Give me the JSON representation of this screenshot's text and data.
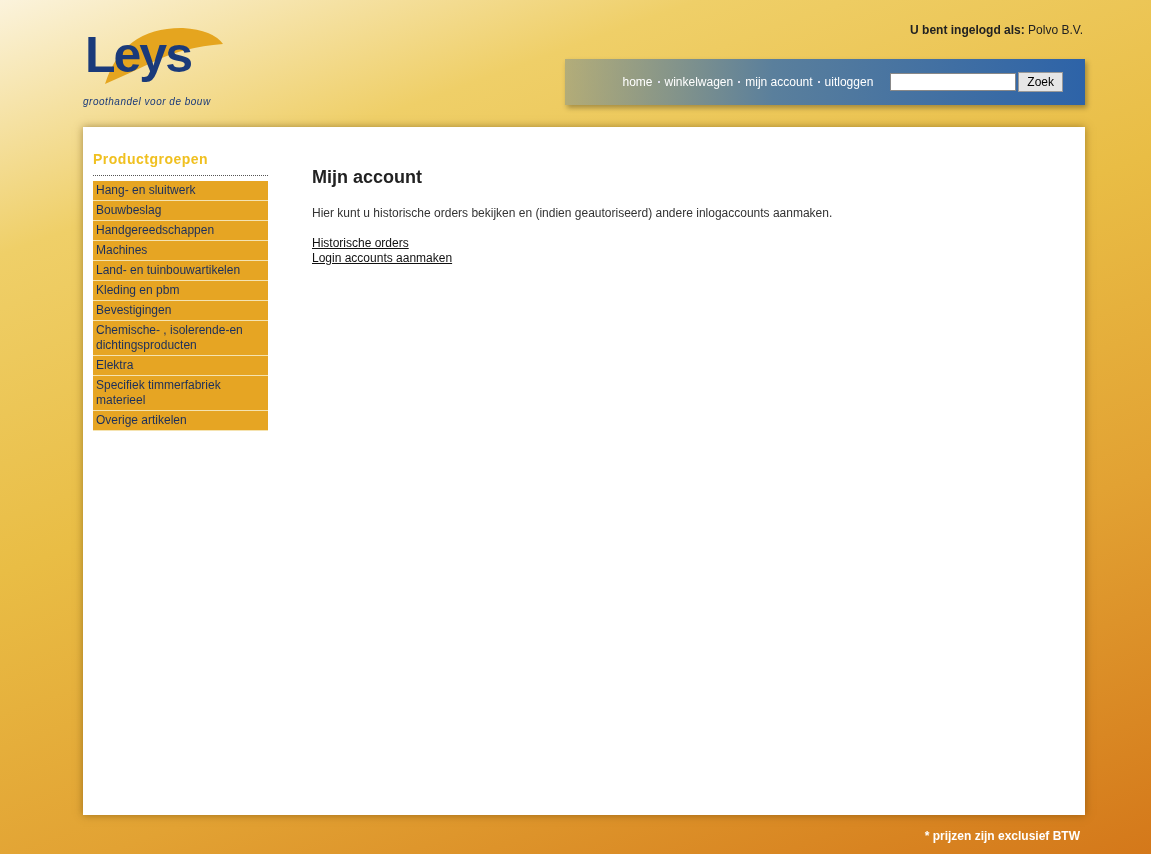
{
  "logo": {
    "name": "Leys",
    "tagline": "groothandel voor de bouw"
  },
  "login_status": "**U bent ingelogd als:** Polvo B.V.",
  "nav": [
    {
      "label": "home"
    },
    {
      "label": "winkelwagen"
    },
    {
      "label": "mijn account"
    },
    {
      "label": "uitloggen"
    }
  ],
  "search": {
    "button": "Zoek"
  },
  "sidebar": {
    "title": "Productgroepen",
    "items": [
      {
        "label": "Hang- en sluitwerk"
      },
      {
        "label": "Bouwbeslag"
      },
      {
        "label": "Handgereedschappen"
      },
      {
        "label": "Machines"
      },
      {
        "label": "Land- en tuinbouwartikelen"
      },
      {
        "label": "Kleding en pbm"
      },
      {
        "label": "Bevestigingen"
      },
      {
        "label": "Chemische- , isolerende-en dichtingsproducten"
      },
      {
        "label": "Elektra"
      },
      {
        "label": "Specifiek timmerfabriek materieel"
      },
      {
        "label": "Overige artikelen"
      }
    ]
  },
  "main": {
    "title": "Mijn account",
    "intro": "Hier kunt u historische orders bekijken en (indien geautoriseerd) andere inlogaccounts aanmaken.",
    "links": [
      {
        "label": "Historische orders"
      },
      {
        "label": "Login accounts aanmaken"
      }
    ]
  },
  "footer_note": "* prijzen zijn exclusief BTW"
}
